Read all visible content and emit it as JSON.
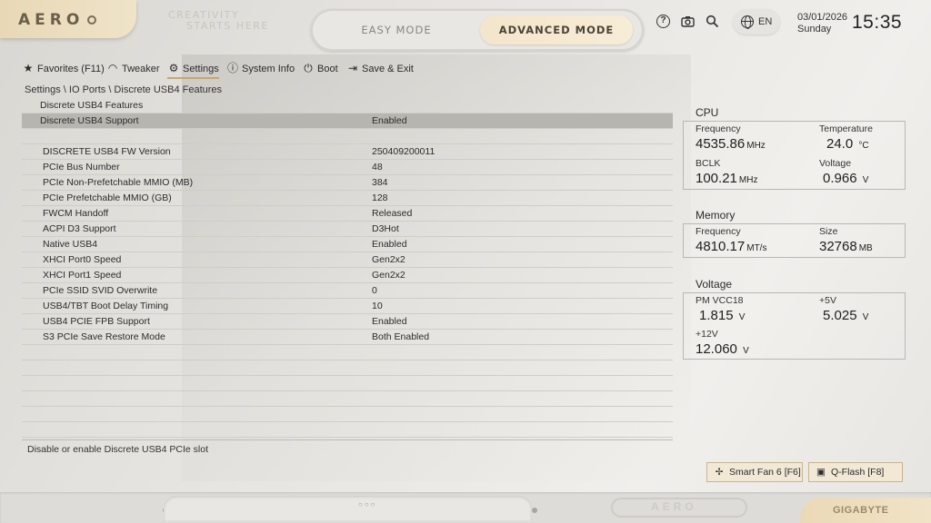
{
  "app": {
    "logo": "AERO",
    "slogan_line1": "CREATIVITY",
    "slogan_line2": "STARTS HERE",
    "brand": "GIGABYTE",
    "bottom_logo": "AERO"
  },
  "modes": {
    "easy": "EASY MODE",
    "advanced": "ADVANCED MODE",
    "active": "advanced"
  },
  "top": {
    "language": "EN",
    "date": "03/01/2026",
    "day": "Sunday",
    "time": "15:35"
  },
  "nav": [
    {
      "label": "Favorites (F11)",
      "icon": "star-icon"
    },
    {
      "label": "Tweaker",
      "icon": "gauge-icon"
    },
    {
      "label": "Settings",
      "icon": "gear-icon"
    },
    {
      "label": "System Info",
      "icon": "info-icon"
    },
    {
      "label": "Boot",
      "icon": "power-icon"
    },
    {
      "label": "Save & Exit",
      "icon": "exit-icon"
    }
  ],
  "breadcrumb": "Settings \\ IO Ports \\ Discrete USB4 Features",
  "table": {
    "header": "Discrete USB4 Features",
    "selected": {
      "label": "Discrete USB4 Support",
      "value": "Enabled"
    },
    "rows": [
      {
        "label": "DISCRETE USB4 FW Version",
        "value": "250409200011"
      },
      {
        "label": "PCIe Bus Number",
        "value": "48"
      },
      {
        "label": "PCIe Non-Prefetchable MMIO (MB)",
        "value": "384"
      },
      {
        "label": "PCIe Prefetchable MMIO (GB)",
        "value": "128"
      },
      {
        "label": "FWCM Handoff",
        "value": "Released"
      },
      {
        "label": "ACPI D3 Support",
        "value": "D3Hot"
      },
      {
        "label": "Native USB4",
        "value": "Enabled"
      },
      {
        "label": "XHCI Port0 Speed",
        "value": "Gen2x2"
      },
      {
        "label": "XHCI Port1 Speed",
        "value": "Gen2x2"
      },
      {
        "label": "PCIe SSID SVID Overwrite",
        "value": "0"
      },
      {
        "label": "USB4/TBT Boot Delay Timing",
        "value": "10"
      },
      {
        "label": "USB4 PCIE FPB Support",
        "value": "Enabled"
      },
      {
        "label": "S3 PCIe Save Restore Mode",
        "value": "Both Enabled"
      }
    ]
  },
  "help_text": "Disable or enable Discrete USB4 PCIe slot",
  "cpu": {
    "title": "CPU",
    "freq_label": "Frequency",
    "freq_value": "4535.86",
    "freq_unit": "MHz",
    "temp_label": "Temperature",
    "temp_value": "24.0",
    "temp_unit": "°C",
    "bclk_label": "BCLK",
    "bclk_value": "100.21",
    "bclk_unit": "MHz",
    "volt_label": "Voltage",
    "volt_value": "0.966",
    "volt_unit": "V"
  },
  "memory": {
    "title": "Memory",
    "freq_label": "Frequency",
    "freq_value": "4810.17",
    "freq_unit": "MT/s",
    "size_label": "Size",
    "size_value": "32768",
    "size_unit": "MB"
  },
  "voltage": {
    "title": "Voltage",
    "pm_label": "PM VCC18",
    "pm_value": "1.815",
    "pm_unit": "V",
    "p5_label": "+5V",
    "p5_value": "5.025",
    "p5_unit": "V",
    "p12_label": "+12V",
    "p12_value": "12.060",
    "p12_unit": "V"
  },
  "buttons": {
    "smart_fan": "Smart Fan 6 [F6]",
    "qflash": "Q-Flash [F8]"
  },
  "colors": {
    "accent_gold": "#c7a673",
    "selected_row": "#b7b5b0"
  }
}
